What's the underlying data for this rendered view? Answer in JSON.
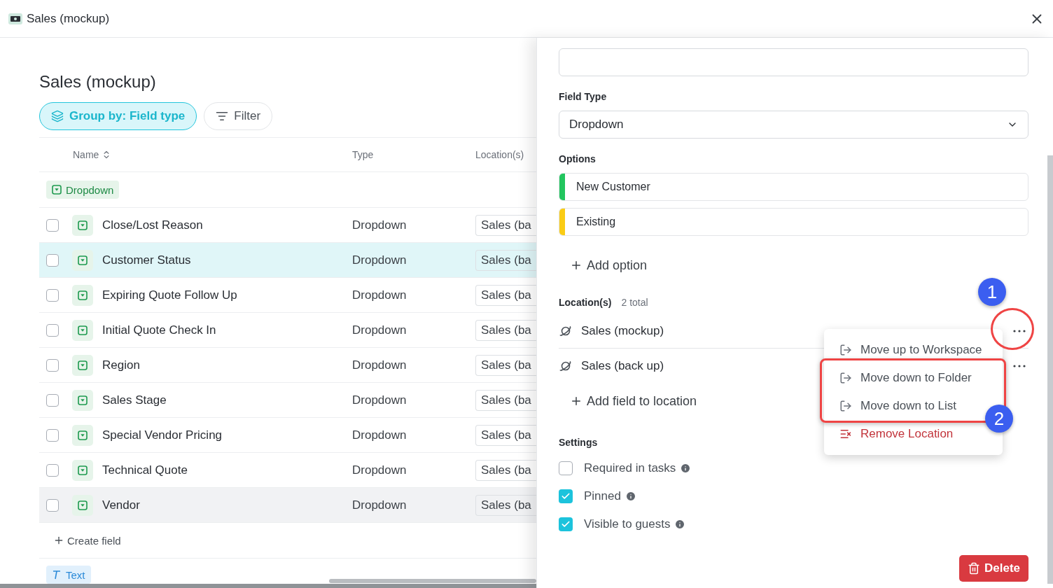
{
  "window": {
    "title": "Sales (mockup)"
  },
  "page": {
    "title": "Sales (mockup)",
    "toolbar": [
      {
        "label": "Group by: Field type",
        "kind": "group",
        "selected": true
      },
      {
        "label": "Filter",
        "kind": "filter",
        "selected": false
      }
    ],
    "table": {
      "columns": [
        {
          "label": "Name",
          "sortable": true
        },
        {
          "label": "Type",
          "sortable": false
        },
        {
          "label": "Location(s)",
          "sortable": false
        }
      ],
      "groups": [
        {
          "label": "Dropdown",
          "kind": "dropdown",
          "rows": [
            {
              "name": "Close/Lost Reason",
              "type": "Dropdown",
              "location": "Sales (ba",
              "checked": false,
              "selected": false,
              "hovered": false
            },
            {
              "name": "Customer Status",
              "type": "Dropdown",
              "location": "Sales (ba",
              "checked": false,
              "selected": true,
              "hovered": false
            },
            {
              "name": "Expiring Quote Follow Up",
              "type": "Dropdown",
              "location": "Sales (ba",
              "checked": false,
              "selected": false,
              "hovered": false
            },
            {
              "name": "Initial Quote Check In",
              "type": "Dropdown",
              "location": "Sales (ba",
              "checked": false,
              "selected": false,
              "hovered": false
            },
            {
              "name": "Region",
              "type": "Dropdown",
              "location": "Sales (ba",
              "checked": false,
              "selected": false,
              "hovered": false
            },
            {
              "name": "Sales Stage",
              "type": "Dropdown",
              "location": "Sales (ba",
              "checked": false,
              "selected": false,
              "hovered": false
            },
            {
              "name": "Special Vendor Pricing",
              "type": "Dropdown",
              "location": "Sales (ba",
              "checked": false,
              "selected": false,
              "hovered": false
            },
            {
              "name": "Technical Quote",
              "type": "Dropdown",
              "location": "Sales (ba",
              "checked": false,
              "selected": false,
              "hovered": false
            },
            {
              "name": "Vendor",
              "type": "Dropdown",
              "location": "Sales (ba",
              "checked": false,
              "selected": false,
              "hovered": true
            }
          ],
          "create_label": "Create field"
        },
        {
          "label": "Text",
          "kind": "text"
        }
      ]
    }
  },
  "panel": {
    "field_type": {
      "label": "Field Type",
      "value": "Dropdown"
    },
    "options": {
      "label": "Options",
      "items": [
        {
          "label": "New Customer",
          "color": "#22c55e"
        },
        {
          "label": "Existing",
          "color": "#facc15"
        }
      ],
      "add_label": "Add option"
    },
    "locations": {
      "label": "Location(s)",
      "count": "2 total",
      "items": [
        {
          "name": "Sales (mockup)"
        },
        {
          "name": "Sales (back up)"
        }
      ],
      "add_label": "Add field to location"
    },
    "settings": {
      "label": "Settings",
      "items": [
        {
          "label": "Required in tasks",
          "checked": false
        },
        {
          "label": "Pinned",
          "checked": true
        },
        {
          "label": "Visible to guests",
          "checked": true
        }
      ]
    },
    "delete_label": "Delete"
  },
  "menu": {
    "items": [
      {
        "label": "Move up to Workspace",
        "kind": "move"
      },
      {
        "label": "Move down to Folder",
        "kind": "move"
      },
      {
        "label": "Move down to List",
        "kind": "move"
      },
      {
        "label": "Remove Location",
        "kind": "remove"
      }
    ]
  },
  "annotations": [
    {
      "label": "1"
    },
    {
      "label": "2"
    }
  ]
}
